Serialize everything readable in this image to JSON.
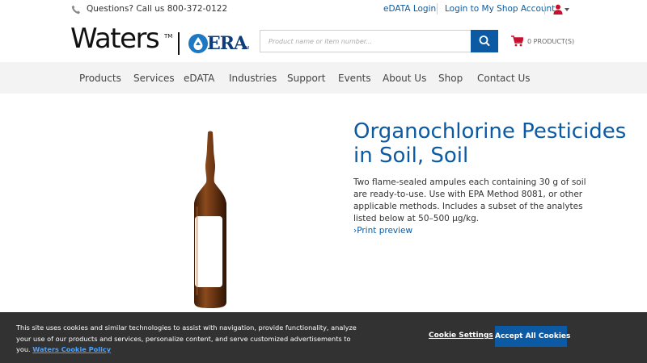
{
  "topbar": {
    "phone_text": "Questions? Call us 800-372-0122",
    "edata_login": "eDATA Login",
    "shop_login": "Login to My Shop Account"
  },
  "header": {
    "logo_waters": "Waters",
    "logo_tm": "TM",
    "logo_era": "ERA",
    "logo_era_tm": "TM",
    "search_placeholder": "Product name or item number...",
    "cart_text": "0 PRODUCT(S)"
  },
  "nav": {
    "items": [
      "Products",
      "Services",
      "eDATA",
      "Industries",
      "Support",
      "Events",
      "About Us",
      "Shop",
      "Contact Us"
    ]
  },
  "product": {
    "title": "Organochlorine Pesticides in Soil, Soil",
    "description": "Two flame-sealed ampules each containing 30 g of soil are ready-to-use. Use with EPA Method 8081, or other applicable methods. Includes a subset of the analytes listed below at 50–500 µg/kg.",
    "print_link": "›Print preview"
  },
  "cookie": {
    "text": "This site uses cookies and similar technologies to assist with navigation, provide functionality, analyze your use of our products and services, personalize content, and serve customized advertisements to you. ",
    "policy_link": "Waters Cookie Policy",
    "settings_label": "Cookie Settings",
    "accept_label": "Accept All Cookies"
  },
  "colors": {
    "brand_blue": "#0b5aa3",
    "banner_bg": "#333233",
    "era_blue": "#1e78c2",
    "cart_red": "#c8102e"
  }
}
